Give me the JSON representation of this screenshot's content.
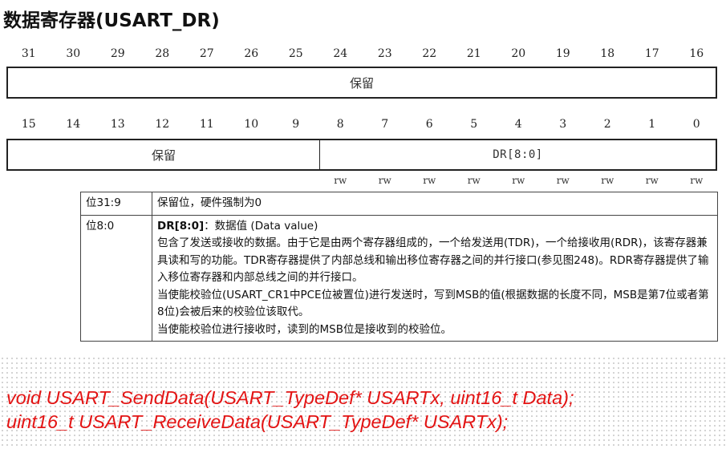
{
  "title": "数据寄存器(USART_DR)",
  "upper_bits": [
    "31",
    "30",
    "29",
    "28",
    "27",
    "26",
    "25",
    "24",
    "23",
    "22",
    "21",
    "20",
    "19",
    "18",
    "17",
    "16"
  ],
  "lower_bits": [
    "15",
    "14",
    "13",
    "12",
    "11",
    "10",
    "9",
    "8",
    "7",
    "6",
    "5",
    "4",
    "3",
    "2",
    "1",
    "0"
  ],
  "upper_register": {
    "reserved_label": "保留"
  },
  "lower_register": {
    "reserved_label": "保留",
    "dr_label": "DR[8:0]"
  },
  "access": [
    "rw",
    "rw",
    "rw",
    "rw",
    "rw",
    "rw",
    "rw",
    "rw",
    "rw"
  ],
  "rows": [
    {
      "bits": "位31:9",
      "text": "保留位，硬件强制为0"
    },
    {
      "bits": "位8:0",
      "field_name": "DR[8:0]",
      "field_desc": "：数据值 (Data value)",
      "para1": "包含了发送或接收的数据。由于它是由两个寄存器组成的，一个给发送用(TDR)，一个给接收用(RDR)，该寄存器兼具读和写的功能。TDR寄存器提供了内部总线和输出移位寄存器之间的并行接口(参见图248)。RDR寄存器提供了输入移位寄存器和内部总线之间的并行接口。",
      "para2": "当使能校验位(USART_CR1中PCE位被置位)进行发送时，写到MSB的值(根据数据的长度不同，MSB是第7位或者第8位)会被后来的校验位该取代。",
      "para3": "当使能校验位进行接收时，读到的MSB位是接收到的校验位。"
    }
  ],
  "code": {
    "line1": "void USART_SendData(USART_TypeDef* USARTx, uint16_t Data);",
    "line2": "uint16_t USART_ReceiveData(USART_TypeDef* USARTx);"
  },
  "colors": {
    "code": "#e31414"
  }
}
